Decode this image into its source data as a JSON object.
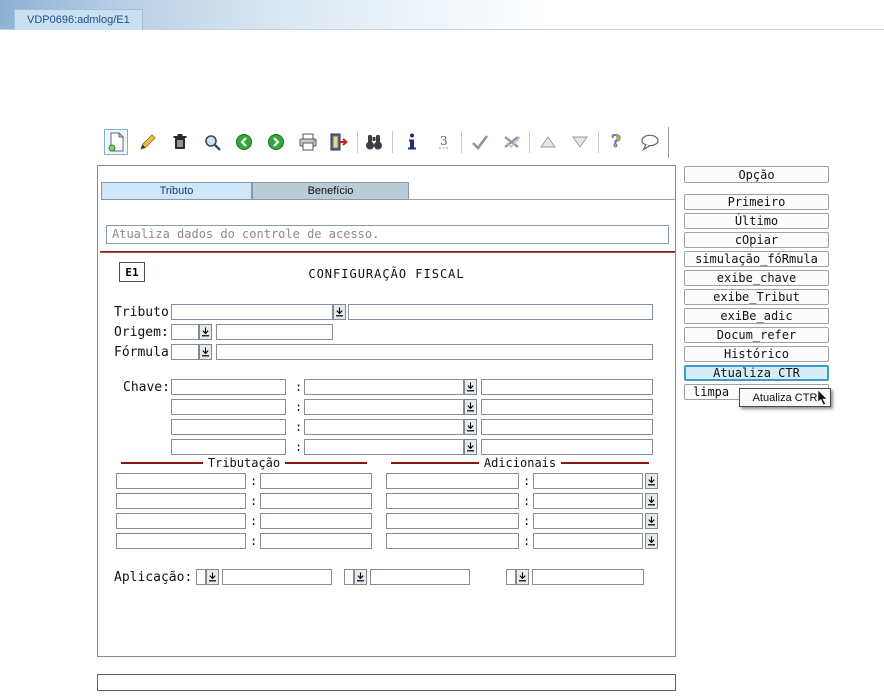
{
  "window": {
    "tab_title": "VDP0696:admlog/E1"
  },
  "toolbar": {
    "icons": [
      "new-record",
      "edit",
      "delete",
      "search",
      "previous",
      "next",
      "print",
      "exit",
      "find",
      "info",
      "sequence",
      "confirm",
      "cancel",
      "move-up",
      "move-down",
      "help",
      "comment"
    ]
  },
  "tabs": {
    "tributo": "Tributo",
    "beneficio": "Benefício"
  },
  "statusbar": {
    "message": "Atualiza dados do controle de acesso."
  },
  "form": {
    "code": "E1",
    "title": "CONFIGURAÇÃO FISCAL",
    "colon": ":",
    "labels": {
      "tributo": "Tributo:",
      "origem": "Origem:",
      "formula": "Fórmula:",
      "chave": "Chave:",
      "aplicacao": "Aplicação:"
    },
    "sections": {
      "tributacao": "Tributação",
      "adicionais": "Adicionais"
    }
  },
  "sidebar": {
    "header": "Opção",
    "buttons": [
      "Primeiro",
      "Último",
      "cOpiar",
      "simulação_fóRmula",
      "exibe_chave",
      "exibe_Tribut",
      "exiBe_adic",
      "Docum_refer",
      "Histórico",
      "Atualiza CTR",
      "limpa"
    ],
    "active": "Atualiza CTR"
  },
  "tooltip": {
    "text": "Atualiza CTR"
  },
  "colors": {
    "accent_maroon": "#8b1515",
    "active_button_bg": "#d6ecf7",
    "active_button_border": "#3d9dc8",
    "tab_selected_bg": "#b9cdd6",
    "tab_unselected_bg": "#cfe6f8"
  }
}
